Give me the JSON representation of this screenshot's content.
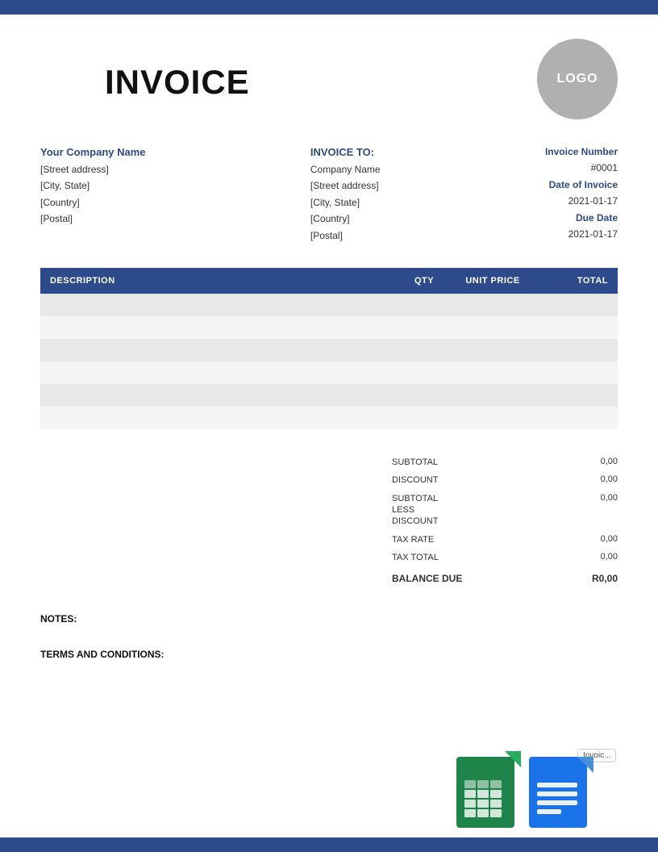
{
  "topBar": {
    "color": "#2d4a8a"
  },
  "header": {
    "title": "INVOICE",
    "logo": "LOGO"
  },
  "sender": {
    "companyName": "Your Company Name",
    "street": "[Street address]",
    "cityState": "[City, State]",
    "country": "[Country]",
    "postal": "[Postal]"
  },
  "recipient": {
    "label": "INVOICE TO:",
    "companyName": "Company Name",
    "street": "[Street address]",
    "cityState": "[City, State]",
    "country": "[Country]",
    "postal": "[Postal]"
  },
  "invoiceDetails": {
    "numberLabel": "Invoice Number",
    "number": "#0001",
    "dateLabel": "Date of Invoice",
    "date": "2021-01-17",
    "dueDateLabel": "Due Date",
    "dueDate": "2021-01-17"
  },
  "table": {
    "headers": [
      "DESCRIPTION",
      "QTY",
      "UNIT PRICE",
      "TOTAL"
    ],
    "rows": [
      {
        "description": "",
        "qty": "",
        "unitPrice": "",
        "total": ""
      },
      {
        "description": "",
        "qty": "",
        "unitPrice": "",
        "total": ""
      },
      {
        "description": "",
        "qty": "",
        "unitPrice": "",
        "total": ""
      },
      {
        "description": "",
        "qty": "",
        "unitPrice": "",
        "total": ""
      },
      {
        "description": "",
        "qty": "",
        "unitPrice": "",
        "total": ""
      },
      {
        "description": "",
        "qty": "",
        "unitPrice": "",
        "total": ""
      }
    ]
  },
  "totals": {
    "subtotalLabel": "SUBTOTAL",
    "subtotalValue": "0,00",
    "discountLabel": "DISCOUNT",
    "discountValue": "0,00",
    "subtotalLessLabel": "SUBTOTAL LESS DISCOUNT",
    "subtotalLessValue": "0,00",
    "taxRateLabel": "TAX RATE",
    "taxRateValue": "0,00",
    "taxTotalLabel": "TAX TOTAL",
    "taxTotalValue": "0,00",
    "balanceDueLabel": "BALANCE DUE",
    "balanceDueValue": "R0,00"
  },
  "notes": {
    "label": "NOTES:"
  },
  "terms": {
    "label": "TERMS AND CONDITIONS:"
  },
  "googleIcons": {
    "sheetsLabel": "",
    "docsLabel": "Invoic..."
  }
}
